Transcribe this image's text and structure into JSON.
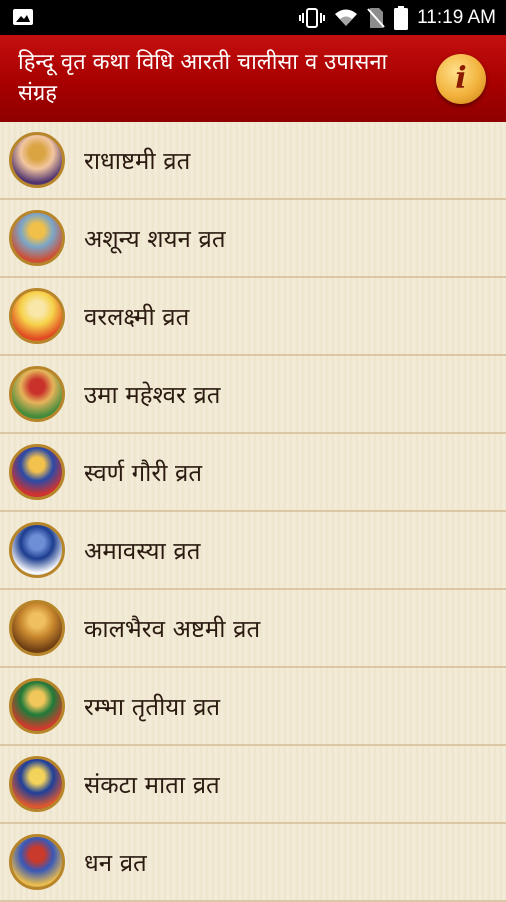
{
  "status_bar": {
    "time": "11:19 AM",
    "icons": [
      "image-notification-icon",
      "vibrate-icon",
      "wifi-icon",
      "no-sim-icon",
      "battery-icon"
    ]
  },
  "app_bar": {
    "title": "हिन्दू वृत कथा विधि आरती चालीसा व उपासना संग्रह",
    "info_button": "i",
    "colors": {
      "bar": "#b30000",
      "info_button": "#f2b23c"
    }
  },
  "list": {
    "items": [
      {
        "label": "राधाष्टमी व्रत",
        "icon": "radha-krishna-image",
        "colors": [
          "#f2c6a0",
          "#4a2e6e",
          "#d9a441"
        ]
      },
      {
        "label": "अशून्य शयन व्रत",
        "icon": "vishnu-lakshmi-image",
        "colors": [
          "#7aa6c9",
          "#d24a2e",
          "#f0c04b"
        ]
      },
      {
        "label": "वरलक्ष्मी व्रत",
        "icon": "lakshmi-image",
        "colors": [
          "#f6d24a",
          "#e04520",
          "#f8e7a8"
        ]
      },
      {
        "label": "उमा महेश्वर व्रत",
        "icon": "parvati-image",
        "colors": [
          "#e6b35a",
          "#3a8a3a",
          "#c8322a"
        ]
      },
      {
        "label": "स्वर्ण गौरी व्रत",
        "icon": "gauri-image",
        "colors": [
          "#2a4aa8",
          "#d8322a",
          "#f3c24d"
        ]
      },
      {
        "label": "अमावस्या व्रत",
        "icon": "vishnu-image",
        "colors": [
          "#1c3d8f",
          "#ffffff",
          "#6d8fd6"
        ]
      },
      {
        "label": "कालभैरव अष्टमी व्रत",
        "icon": "bhairav-image",
        "colors": [
          "#c9882e",
          "#6a3a12",
          "#f0c060"
        ]
      },
      {
        "label": "रम्भा तृतीया व्रत",
        "icon": "rambha-image",
        "colors": [
          "#1f7a3a",
          "#d7382c",
          "#f1c65b"
        ]
      },
      {
        "label": "संकटा माता व्रत",
        "icon": "sankata-mata-image",
        "colors": [
          "#1e3f9a",
          "#e55a2a",
          "#f3d35a"
        ]
      },
      {
        "label": "धन व्रत",
        "icon": "vishnu-blessing-image",
        "colors": [
          "#3858b8",
          "#efc04a",
          "#c93a2a"
        ]
      }
    ]
  }
}
